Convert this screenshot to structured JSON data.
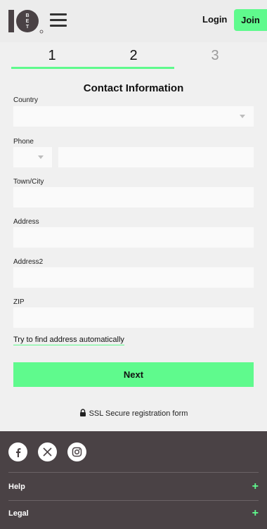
{
  "header": {
    "login_label": "Login",
    "join_label": "Join",
    "logo_text": "10BET",
    "accent": "#5ffa8d"
  },
  "steps": {
    "items": [
      "1",
      "2",
      "3"
    ],
    "active_step": 2
  },
  "form": {
    "title": "Contact Information",
    "country_label": "Country",
    "phone_label": "Phone",
    "town_label": "Town/City",
    "address_label": "Address",
    "address2_label": "Address2",
    "zip_label": "ZIP",
    "find_address_link": "Try to find address automatically",
    "next_label": "Next",
    "ssl_text": "SSL Secure registration form"
  },
  "footer": {
    "social": [
      "facebook-icon",
      "x-icon",
      "instagram-icon"
    ],
    "help_label": "Help",
    "legal_label": "Legal",
    "bg": "#4a4245"
  }
}
